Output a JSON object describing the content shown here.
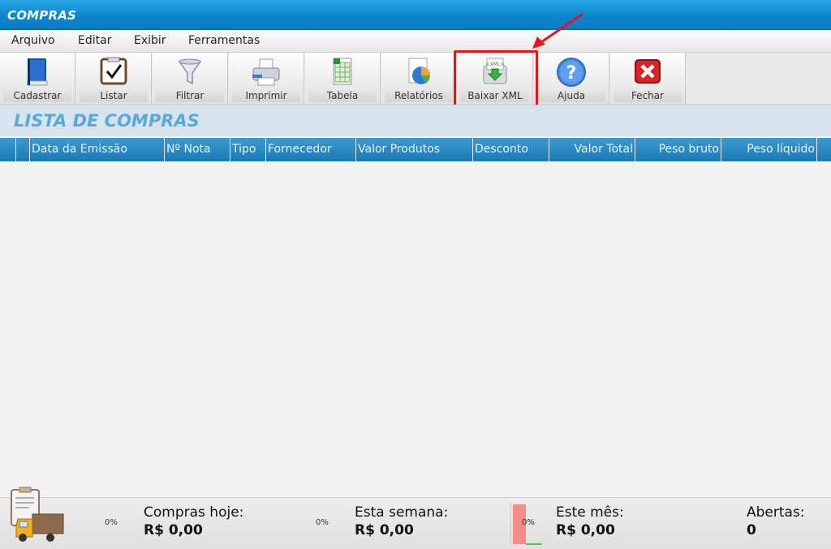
{
  "window": {
    "title": "COMPRAS"
  },
  "menu": [
    "Arquivo",
    "Editar",
    "Exibir",
    "Ferramentas"
  ],
  "toolbar": {
    "buttons": [
      {
        "label": "Cadastrar",
        "icon": "book-icon"
      },
      {
        "label": "Listar",
        "icon": "checklist-icon"
      },
      {
        "label": "Filtrar",
        "icon": "funnel-icon"
      },
      {
        "label": "Imprimir",
        "icon": "printer-icon"
      },
      {
        "label": "Tabela",
        "icon": "spreadsheet-icon"
      },
      {
        "label": "Relatórios",
        "icon": "pie-chart-icon"
      },
      {
        "label": "Baixar XML",
        "icon": "xml-download-icon"
      },
      {
        "label": "Ajuda",
        "icon": "help-icon"
      },
      {
        "label": "Fechar",
        "icon": "close-icon"
      }
    ],
    "highlighted": "Baixar XML"
  },
  "page": {
    "heading": "LISTA DE COMPRAS"
  },
  "table": {
    "columns": [
      "",
      "",
      "Data da Emissão",
      "Nº Nota",
      "Tipo",
      "Fornecedor",
      "Valor Produtos",
      "Desconto",
      "Valor Total",
      "Peso bruto",
      "Peso líquido"
    ],
    "rows": []
  },
  "footer": {
    "today": {
      "label": "Compras hoje:",
      "value": "R$ 0,00",
      "percent": "0%"
    },
    "week": {
      "label": "Esta semana:",
      "value": "R$ 0,00",
      "percent": "0%"
    },
    "month": {
      "label": "Este mês:",
      "value": "R$ 0,00",
      "percent": "0%"
    },
    "open": {
      "label": "Abertas:",
      "value": "0"
    }
  },
  "colors": {
    "titlebar": "#0b86cf",
    "heading": "#5aa9dd",
    "highlight": "#e8141b"
  }
}
